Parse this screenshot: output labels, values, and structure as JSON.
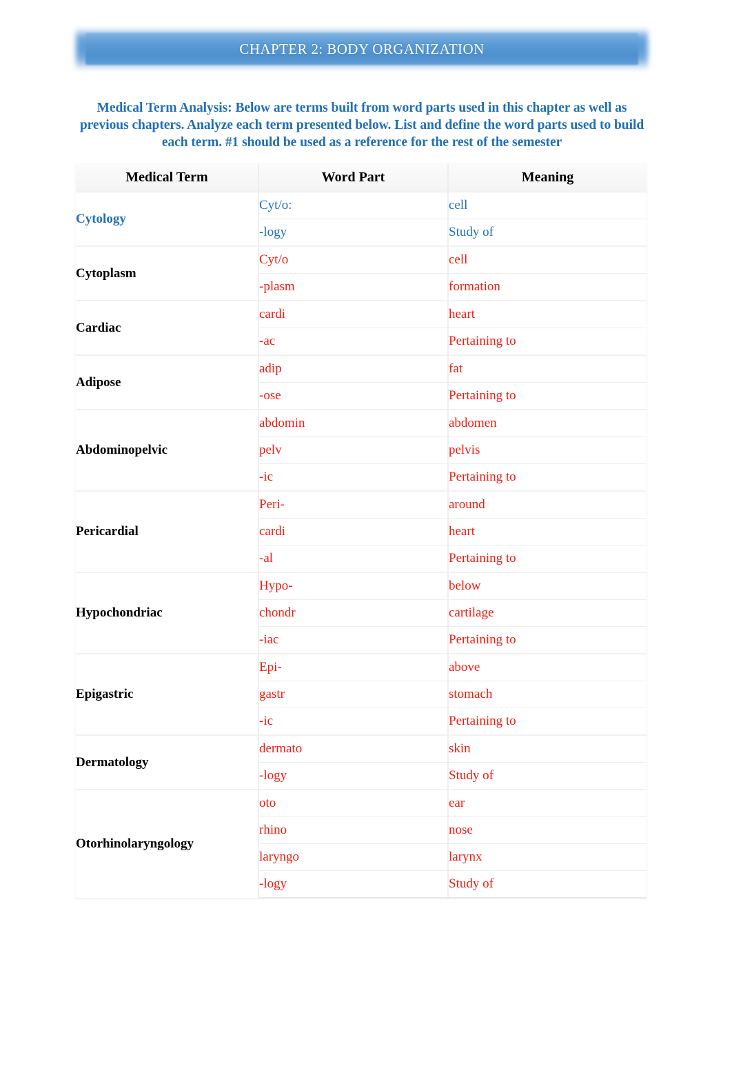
{
  "banner": {
    "title": "CHAPTER 2: BODY ORGANIZATION",
    "bg_color": "#5b9bd5",
    "text_color": "#ffffff"
  },
  "intro": {
    "text": "Medical Term Analysis: Below are terms built from word parts used in this chapter as well as previous chapters. Analyze each term presented below. List and define the word parts used to build each term. #1 should be used as a reference for the rest of the semester",
    "color": "#1f6fb5"
  },
  "table": {
    "headers": [
      "Medical Term",
      "Word Part",
      "Meaning"
    ],
    "example_color": "#1f6fb5",
    "answer_color": "#ee1c10",
    "rows": [
      {
        "term": "Cytology",
        "style": "example",
        "parts": [
          {
            "part": "Cyt/o:",
            "meaning": "cell"
          },
          {
            "part": "-logy",
            "meaning": "Study of"
          }
        ]
      },
      {
        "term": "Cytoplasm",
        "style": "normal",
        "parts": [
          {
            "part": "Cyt/o",
            "meaning": "cell"
          },
          {
            "part": "-plasm",
            "meaning": "formation"
          }
        ]
      },
      {
        "term": "Cardiac",
        "style": "normal",
        "parts": [
          {
            "part": "cardi",
            "meaning": "heart"
          },
          {
            "part": "-ac",
            "meaning": "Pertaining to"
          }
        ]
      },
      {
        "term": "Adipose",
        "style": "normal",
        "parts": [
          {
            "part": "adip",
            "meaning": "fat"
          },
          {
            "part": "-ose",
            "meaning": "Pertaining to"
          }
        ]
      },
      {
        "term": "Abdominopelvic",
        "style": "normal",
        "parts": [
          {
            "part": "abdomin",
            "meaning": "abdomen"
          },
          {
            "part": "pelv",
            "meaning": "pelvis"
          },
          {
            "part": "-ic",
            "meaning": "Pertaining to"
          }
        ]
      },
      {
        "term": "Pericardial",
        "style": "normal",
        "parts": [
          {
            "part": "Peri-",
            "meaning": "around"
          },
          {
            "part": "cardi",
            "meaning": "heart"
          },
          {
            "part": "-al",
            "meaning": "Pertaining to"
          }
        ]
      },
      {
        "term": "Hypochondriac",
        "style": "normal",
        "parts": [
          {
            "part": "Hypo-",
            "meaning": "below"
          },
          {
            "part": "chondr",
            "meaning": "cartilage"
          },
          {
            "part": "-iac",
            "meaning": "Pertaining to"
          }
        ]
      },
      {
        "term": "Epigastric",
        "style": "normal",
        "parts": [
          {
            "part": "Epi-",
            "meaning": "above"
          },
          {
            "part": "gastr",
            "meaning": "stomach"
          },
          {
            "part": "-ic",
            "meaning": "Pertaining to"
          }
        ]
      },
      {
        "term": "Dermatology",
        "style": "normal",
        "parts": [
          {
            "part": "dermato",
            "meaning": "skin"
          },
          {
            "part": "-logy",
            "meaning": "Study of"
          }
        ]
      },
      {
        "term": "Otorhinolaryngology",
        "style": "normal",
        "parts": [
          {
            "part": "oto",
            "meaning": "ear"
          },
          {
            "part": "rhino",
            "meaning": "nose"
          },
          {
            "part": "laryngo",
            "meaning": "larynx"
          },
          {
            "part": "-logy",
            "meaning": "Study of"
          }
        ]
      }
    ]
  }
}
